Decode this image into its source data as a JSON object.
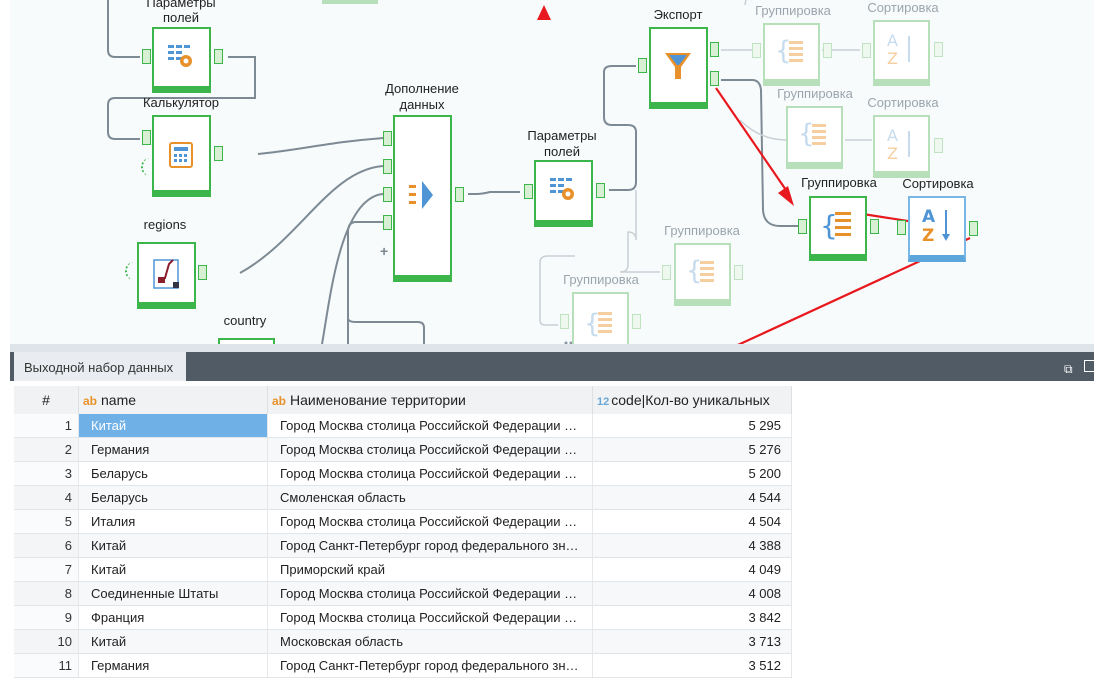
{
  "canvas": {
    "nodes": {
      "params1": {
        "label_line1": "Параметры",
        "label_line2": "полей"
      },
      "calc": {
        "label": "Калькулятор"
      },
      "regions": {
        "label": "regions"
      },
      "country": {
        "label": "country"
      },
      "join": {
        "label_line1": "Дополнение",
        "label_line2": "данных"
      },
      "params2": {
        "label_line1": "Параметры",
        "label_line2": "полей"
      },
      "export": {
        "label": "Экспорт"
      },
      "group_faded1": {
        "label": "Группировка"
      },
      "sort_faded1": {
        "label": "Сортировка"
      },
      "group_faded2": {
        "label": "Группировка"
      },
      "sort_faded2": {
        "label": "Сортировка"
      },
      "group_active": {
        "label": "Группировка"
      },
      "sort_active": {
        "label": "Сортировка"
      },
      "group_faded3": {
        "label": "Группировка"
      },
      "group_faded4": {
        "label": "Группировка"
      }
    },
    "annotation_color": "#e8191e",
    "node_accent": "#3cb54a"
  },
  "panel": {
    "tab_label": "Выходной набор данных"
  },
  "table": {
    "headers": {
      "index": "#",
      "name_type": "ab",
      "name": "name",
      "territory_type": "ab",
      "territory": "Наименование территории",
      "count_type": "12",
      "count": "code|Кол-во уникальных"
    },
    "rows": [
      {
        "idx": "1",
        "name": "Китай",
        "territory": "Город Москва столица Российской Федерации …",
        "count": "5 295"
      },
      {
        "idx": "2",
        "name": "Германия",
        "territory": "Город Москва столица Российской Федерации …",
        "count": "5 276"
      },
      {
        "idx": "3",
        "name": "Беларусь",
        "territory": "Город Москва столица Российской Федерации …",
        "count": "5 200"
      },
      {
        "idx": "4",
        "name": "Беларусь",
        "territory": "Смоленская область",
        "count": "4 544"
      },
      {
        "idx": "5",
        "name": "Италия",
        "territory": "Город Москва столица Российской Федерации …",
        "count": "4 504"
      },
      {
        "idx": "6",
        "name": "Китай",
        "territory": "Город Санкт-Петербург город федерального зн…",
        "count": "4 388"
      },
      {
        "idx": "7",
        "name": "Китай",
        "territory": "Приморский край",
        "count": "4 049"
      },
      {
        "idx": "8",
        "name": "Соединенные Штаты",
        "territory": "Город Москва столица Российской Федерации …",
        "count": "4 008"
      },
      {
        "idx": "9",
        "name": "Франция",
        "territory": "Город Москва столица Российской Федерации …",
        "count": "3 842"
      },
      {
        "idx": "10",
        "name": "Китай",
        "territory": "Московская область",
        "count": "3 713"
      },
      {
        "idx": "11",
        "name": "Германия",
        "territory": "Город Санкт-Петербург город федерального зн…",
        "count": "3 512"
      }
    ]
  }
}
